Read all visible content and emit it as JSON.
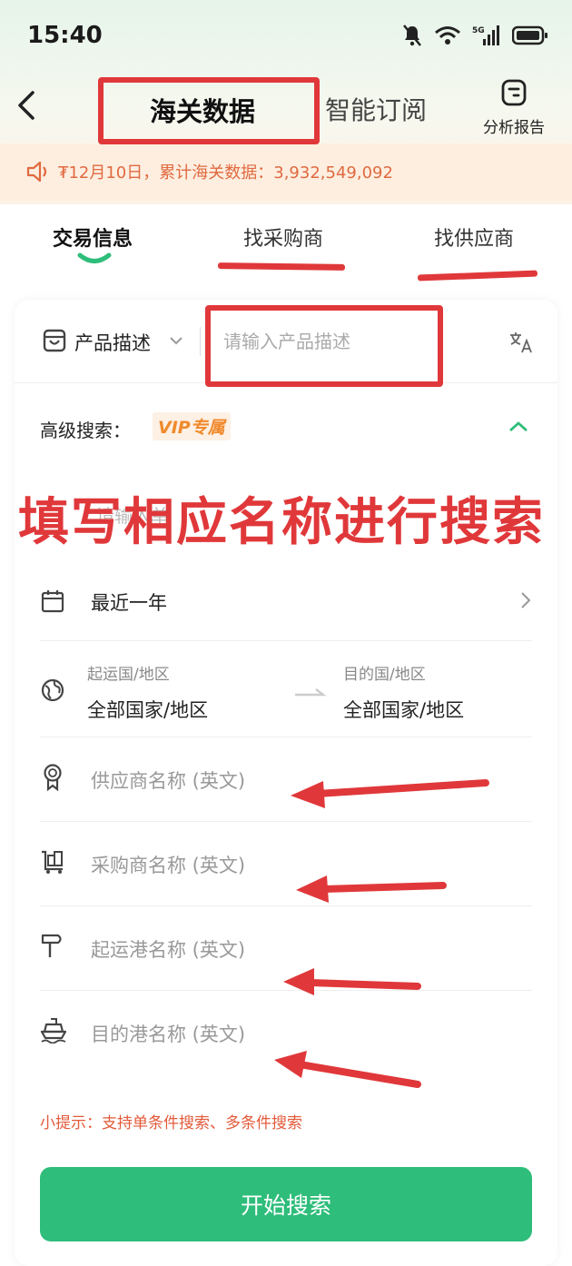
{
  "status_bar": {
    "time": "15:40",
    "network": "5G"
  },
  "nav": {
    "tab_main": "海关数据",
    "tab_sub": "智能订阅",
    "report_label": "分析报告"
  },
  "notice": {
    "text": "₮12月10日，累计海关数据：3,932,549,092"
  },
  "tabs": [
    {
      "label": "交易信息"
    },
    {
      "label": "找采购商"
    },
    {
      "label": "找供应商"
    }
  ],
  "search": {
    "field_type": "产品描述",
    "placeholder": "请输入产品描述"
  },
  "advanced": {
    "label": "高级搜索：",
    "vip": "VIP专属"
  },
  "obscured_field": {
    "text": "请输入单"
  },
  "date_range": {
    "value": "最近一年"
  },
  "origin": {
    "label": "起运国/地区",
    "value": "全部国家/地区"
  },
  "destination": {
    "label": "目的国/地区",
    "value": "全部国家/地区"
  },
  "fields": {
    "supplier": "供应商名称 (英文)",
    "buyer": "采购商名称 (英文)",
    "origin_port": "起运港名称 (英文)",
    "dest_port": "目的港名称 (英文)"
  },
  "hint": "小提示：支持单条件搜索、多条件搜索",
  "search_button": "开始搜索",
  "annotation": {
    "banner": "填写相应名称进行搜索"
  },
  "colors": {
    "accent": "#2ebd7a",
    "annotation": "#e0383a",
    "notice": "#e06a40"
  }
}
